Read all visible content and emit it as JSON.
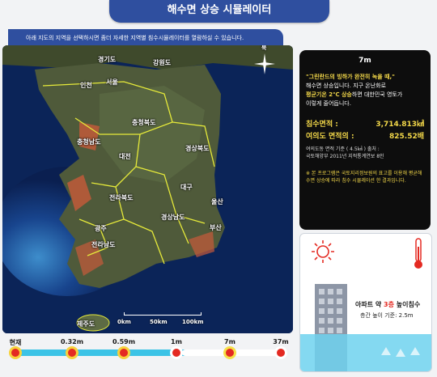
{
  "header": {
    "title": "해수면 상승 시뮬레이터"
  },
  "instruction": "아래 지도의 지역을 선택하시면 좀더 자세한 지역별 침수시뮬레이터를 열람하실 수 있습니다.",
  "map": {
    "compass_label": "북",
    "regions": [
      "경기도",
      "강원도",
      "인천",
      "서울",
      "충청북도",
      "충청남도",
      "대전",
      "경상북도",
      "전라북도",
      "대구",
      "울산",
      "경상남도",
      "부산",
      "광주",
      "전라남도",
      "제주도"
    ],
    "scale_labels": [
      "0km",
      "50km",
      "100km"
    ]
  },
  "timeline": {
    "stops": [
      "현재",
      "0.32m",
      "0.59m",
      "1m",
      "7m",
      "37m"
    ]
  },
  "info": {
    "level": "7m",
    "quote": "\"그린란드의 빙하가 완전히 녹을 때,\"",
    "line1": "해수면 상승입니다. 지구 온난화로",
    "line2_strong": "평균기온 2℃ 상승",
    "line2_rest": "하면 대한민국 영토가",
    "line3": "이렇게 줄어듭니다.",
    "area_label": "침수면적 :",
    "area_value": "3,714.813㎢",
    "yeouido_label": "여의도 면적의 :",
    "yeouido_value": "825.52배",
    "ref1": "여의도동 면적 기준 ( 4.5㎢ ) 출처 :",
    "ref2": "국토해양부 2011년 지적통계연보 8인",
    "note": "※ 본 프로그램은 국토지리정보원의 표고를 이용해 평균해수면 상승에 따라 침수 시뮬레이션 한 결과입니다."
  },
  "apartment": {
    "caption_pre": "아파트 약 ",
    "caption_num": "3층",
    "caption_post": " 높이침수",
    "sub": "층간 높이 기준: 2.5m"
  }
}
